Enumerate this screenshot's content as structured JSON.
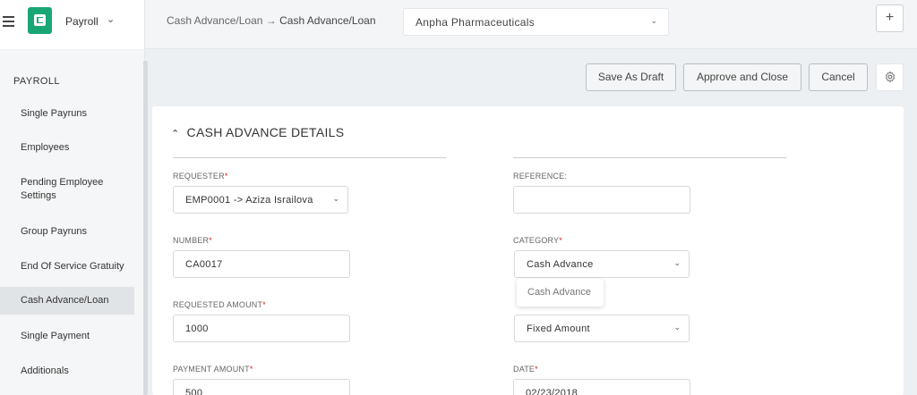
{
  "header": {
    "app_name": "Payroll",
    "breadcrumb_parent": "Cash Advance/Loan",
    "breadcrumb_sep": "→",
    "breadcrumb_current": "Cash Advance/Loan",
    "company": "Anpha Pharmaceuticals",
    "plus": "+"
  },
  "sidebar": {
    "heading": "PAYROLL",
    "items": [
      {
        "label": "Single Payruns"
      },
      {
        "label": "Employees"
      },
      {
        "label": "Pending Employee Settings"
      },
      {
        "label": "Group Payruns"
      },
      {
        "label": "End Of Service Gratuity"
      },
      {
        "label": "Cash Advance/Loan"
      },
      {
        "label": "Single Payment"
      },
      {
        "label": "Additionals"
      }
    ],
    "active_index": 5
  },
  "actions": {
    "save_draft": "Save As Draft",
    "approve_close": "Approve and Close",
    "cancel": "Cancel"
  },
  "form": {
    "section_title": "CASH ADVANCE DETAILS",
    "requester_label": "REQUESTER",
    "requester_value": "EMP0001 -> Aziza Israilova",
    "reference_label": "REFERENCE:",
    "reference_value": "",
    "number_label": "NUMBER",
    "number_value": "CA0017",
    "category_label": "CATEGORY",
    "category_value": "Cash Advance",
    "category_option": "Cash Advance",
    "requested_amount_label": "REQUESTED AMOUNT",
    "requested_amount_value": "1000",
    "type_value": "Fixed Amount",
    "payment_amount_label": "PAYMENT AMOUNT",
    "payment_amount_value": "500",
    "date_label": "DATE",
    "date_value": "02/23/2018",
    "required_mark": "*"
  },
  "colors": {
    "brand": "#1aa674",
    "required": "#d9232d"
  }
}
